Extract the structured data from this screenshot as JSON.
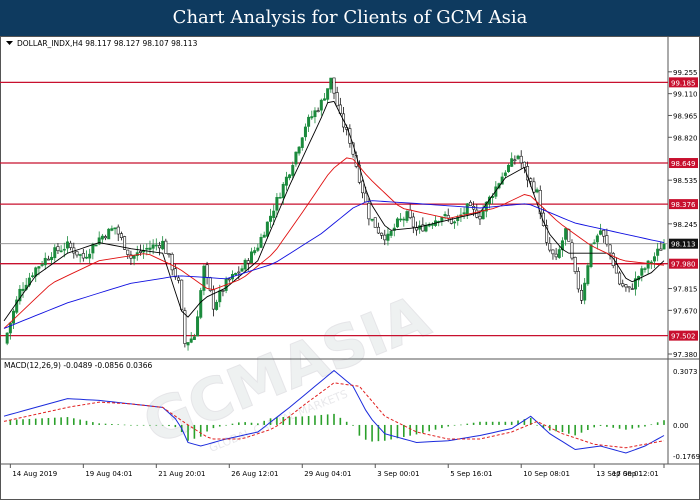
{
  "banner": {
    "title": "Chart Analysis for Clients of GCM Asia"
  },
  "watermark": {
    "text": "GCMASIA",
    "subtext": "GLOBAL CAPITAL MARKETS"
  },
  "colors": {
    "bull": "#1a8a3c",
    "bear": "#111111",
    "ma_fast": "#000000",
    "ma_mid": "#e01010",
    "ma_slow": "#1010e0",
    "level": "#c8102e",
    "macd_line": "#1a2adc",
    "macd_signal": "#e02020",
    "hist": "#2aa02a",
    "banner_bg": "#0e3a5f"
  },
  "chart_data": [
    {
      "type": "candlestick",
      "symbol_header": "DOLLAR_INDX,H4  98.117 98.127 98.107 98.113",
      "ylim": [
        97.38,
        99.4
      ],
      "y_ticks": [
        "99.255",
        "99.110",
        "98.965",
        "98.820",
        "98.535",
        "98.245",
        "97.815",
        "97.670",
        "97.380"
      ],
      "x_ticks": [
        "14 Aug 2019",
        "19 Aug 04:01",
        "21 Aug 20:01",
        "26 Aug 12:01",
        "29 Aug 04:01",
        "3 Sep 00:01",
        "5 Sep 16:01",
        "10 Sep 08:01",
        "13 Sep 00:01",
        "17 Sep 12:01"
      ],
      "levels": [
        {
          "label": "99.185",
          "value": 99.185
        },
        {
          "label": "98.649",
          "value": 98.649
        },
        {
          "label": "98.376",
          "value": 98.376
        },
        {
          "label": "97.980",
          "value": 97.98
        },
        {
          "label": "97.502",
          "value": 97.502
        }
      ],
      "current_price": {
        "label": "98.113",
        "value": 98.113
      },
      "close_path": [
        [
          0,
          97.45
        ],
        [
          5,
          97.8
        ],
        [
          10,
          97.95
        ],
        [
          15,
          98.05
        ],
        [
          20,
          98.1
        ],
        [
          25,
          98.02
        ],
        [
          30,
          98.15
        ],
        [
          35,
          98.22
        ],
        [
          40,
          98.02
        ],
        [
          45,
          98.08
        ],
        [
          50,
          98.12
        ],
        [
          55,
          97.85
        ],
        [
          57,
          97.45
        ],
        [
          60,
          97.5
        ],
        [
          63,
          97.95
        ],
        [
          66,
          97.7
        ],
        [
          70,
          97.85
        ],
        [
          75,
          97.95
        ],
        [
          80,
          98.1
        ],
        [
          85,
          98.35
        ],
        [
          90,
          98.6
        ],
        [
          95,
          98.9
        ],
        [
          100,
          99.05
        ],
        [
          103,
          99.2
        ],
        [
          106,
          98.95
        ],
        [
          109,
          98.8
        ],
        [
          112,
          98.55
        ],
        [
          115,
          98.3
        ],
        [
          118,
          98.2
        ],
        [
          121,
          98.15
        ],
        [
          124,
          98.25
        ],
        [
          127,
          98.3
        ],
        [
          130,
          98.2
        ],
        [
          134,
          98.25
        ],
        [
          138,
          98.3
        ],
        [
          142,
          98.25
        ],
        [
          146,
          98.35
        ],
        [
          150,
          98.3
        ],
        [
          154,
          98.45
        ],
        [
          158,
          98.6
        ],
        [
          162,
          98.7
        ],
        [
          165,
          98.55
        ],
        [
          168,
          98.45
        ],
        [
          171,
          98.1
        ],
        [
          174,
          98.0
        ],
        [
          177,
          98.2
        ],
        [
          180,
          97.9
        ],
        [
          182,
          97.75
        ],
        [
          185,
          98.1
        ],
        [
          188,
          98.2
        ],
        [
          191,
          98.05
        ],
        [
          194,
          97.85
        ],
        [
          197,
          97.8
        ],
        [
          200,
          97.9
        ],
        [
          204,
          98.0
        ],
        [
          208,
          98.113
        ]
      ],
      "ma": [
        {
          "id": "fast",
          "points": [
            [
              0,
              97.6
            ],
            [
              10,
              97.9
            ],
            [
              20,
              98.05
            ],
            [
              30,
              98.12
            ],
            [
              40,
              98.08
            ],
            [
              50,
              98.05
            ],
            [
              57,
              97.6
            ],
            [
              63,
              97.75
            ],
            [
              70,
              97.82
            ],
            [
              80,
              98.0
            ],
            [
              90,
              98.5
            ],
            [
              100,
              98.95
            ],
            [
              103,
              99.1
            ],
            [
              109,
              98.85
            ],
            [
              115,
              98.4
            ],
            [
              121,
              98.2
            ],
            [
              130,
              98.22
            ],
            [
              140,
              98.27
            ],
            [
              150,
              98.32
            ],
            [
              158,
              98.55
            ],
            [
              164,
              98.62
            ],
            [
              171,
              98.2
            ],
            [
              177,
              98.05
            ],
            [
              185,
              98.05
            ],
            [
              191,
              98.05
            ],
            [
              197,
              97.85
            ],
            [
              204,
              97.92
            ],
            [
              208,
              98.0
            ]
          ]
        },
        {
          "id": "mid",
          "points": [
            [
              0,
              97.55
            ],
            [
              15,
              97.85
            ],
            [
              30,
              98.0
            ],
            [
              45,
              98.05
            ],
            [
              55,
              97.95
            ],
            [
              65,
              97.8
            ],
            [
              75,
              97.88
            ],
            [
              85,
              98.05
            ],
            [
              95,
              98.35
            ],
            [
              103,
              98.6
            ],
            [
              109,
              98.7
            ],
            [
              115,
              98.55
            ],
            [
              125,
              98.35
            ],
            [
              140,
              98.28
            ],
            [
              155,
              98.35
            ],
            [
              165,
              98.45
            ],
            [
              175,
              98.25
            ],
            [
              185,
              98.1
            ],
            [
              195,
              98.0
            ],
            [
              208,
              97.97
            ]
          ]
        },
        {
          "id": "slow",
          "points": [
            [
              0,
              97.55
            ],
            [
              20,
              97.72
            ],
            [
              40,
              97.85
            ],
            [
              55,
              97.9
            ],
            [
              70,
              97.88
            ],
            [
              85,
              97.98
            ],
            [
              100,
              98.18
            ],
            [
              110,
              98.35
            ],
            [
              115,
              98.4
            ],
            [
              130,
              98.38
            ],
            [
              150,
              98.35
            ],
            [
              165,
              98.38
            ],
            [
              180,
              98.25
            ],
            [
              195,
              98.18
            ],
            [
              208,
              98.12
            ]
          ]
        }
      ]
    },
    {
      "type": "line",
      "title": "MACD(12,26,9) -0.0489 -0.0856 0.0366",
      "ylim": [
        -0.1769,
        0.3073
      ],
      "y_ticks": [
        "0.3073",
        "0.00",
        "-0.1769"
      ],
      "series": [
        {
          "id": "macd",
          "points": [
            [
              0,
              0.05
            ],
            [
              10,
              0.1
            ],
            [
              20,
              0.15
            ],
            [
              30,
              0.14
            ],
            [
              40,
              0.12
            ],
            [
              50,
              0.1
            ],
            [
              55,
              0.02
            ],
            [
              58,
              -0.1
            ],
            [
              62,
              -0.12
            ],
            [
              70,
              -0.08
            ],
            [
              80,
              -0.04
            ],
            [
              90,
              0.1
            ],
            [
              100,
              0.25
            ],
            [
              104,
              0.31
            ],
            [
              110,
              0.22
            ],
            [
              115,
              0.05
            ],
            [
              120,
              -0.05
            ],
            [
              130,
              -0.1
            ],
            [
              140,
              -0.09
            ],
            [
              150,
              -0.06
            ],
            [
              160,
              -0.02
            ],
            [
              166,
              0.05
            ],
            [
              172,
              -0.05
            ],
            [
              180,
              -0.14
            ],
            [
              188,
              -0.12
            ],
            [
              196,
              -0.16
            ],
            [
              202,
              -0.12
            ],
            [
              208,
              -0.06
            ]
          ]
        },
        {
          "id": "signal",
          "points": [
            [
              0,
              0.02
            ],
            [
              10,
              0.06
            ],
            [
              20,
              0.1
            ],
            [
              30,
              0.13
            ],
            [
              40,
              0.12
            ],
            [
              50,
              0.1
            ],
            [
              58,
              0.0
            ],
            [
              65,
              -0.08
            ],
            [
              75,
              -0.08
            ],
            [
              85,
              -0.02
            ],
            [
              95,
              0.12
            ],
            [
              104,
              0.24
            ],
            [
              112,
              0.22
            ],
            [
              120,
              0.05
            ],
            [
              130,
              -0.04
            ],
            [
              140,
              -0.08
            ],
            [
              150,
              -0.08
            ],
            [
              160,
              -0.04
            ],
            [
              168,
              0.02
            ],
            [
              176,
              -0.05
            ],
            [
              186,
              -0.11
            ],
            [
              196,
              -0.13
            ],
            [
              208,
              -0.09
            ]
          ]
        }
      ],
      "histogram_hint": "positive then negative bars"
    }
  ]
}
